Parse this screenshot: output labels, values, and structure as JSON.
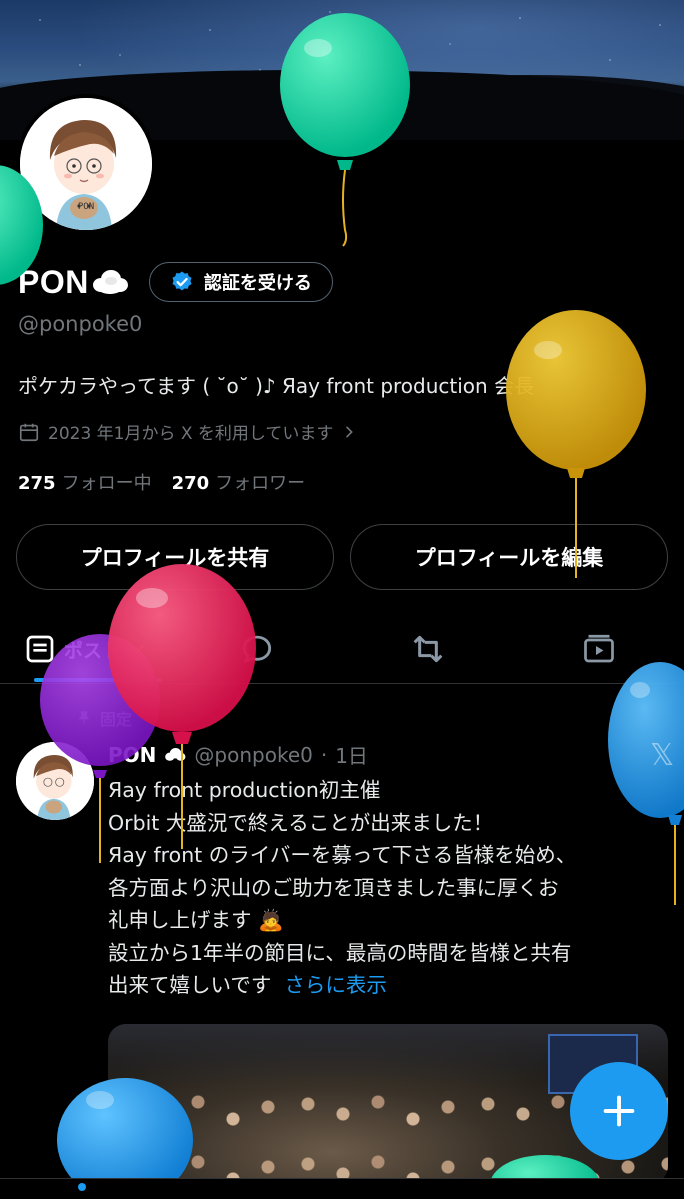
{
  "profile": {
    "display_name": "PON",
    "verify_button": "認証を受ける",
    "handle": "@ponpoke0",
    "bio": "ポケカラやってます ( ˘o˘ )♪ Яay front production 会長",
    "joined": "2023 年1月から X を利用しています",
    "following_count": "275",
    "following_label": "フォロー中",
    "followers_count": "270",
    "followers_label": "フォロワー"
  },
  "buttons": {
    "share_profile": "プロフィールを共有",
    "edit_profile": "プロフィールを編集"
  },
  "tabs": {
    "posts": "ポスト"
  },
  "post": {
    "pinned_label": "固定",
    "author": "PON",
    "handle": "@ponpoke0",
    "time": "1日",
    "lines": [
      "Яay front production初主催",
      "Orbit 大盛況で終えることが出来ました！",
      "Яay front のライバーを募って下さる皆様を始め、",
      "各方面より沢山のご助力を頂きました事に厚くお",
      "礼申し上げます 🙇",
      "設立から1年半の節目に、最高の時間を皆様と共有"
    ],
    "last_line": "出来て嬉しいです",
    "show_more": "さらに表示"
  },
  "avatar_caption": "PON",
  "colors": {
    "accent": "#1d9bf0",
    "muted": "#71767b"
  },
  "icons": [
    "calendar-icon",
    "chevron-right-icon",
    "verified-badge-icon",
    "pin-icon",
    "chevron-down-icon",
    "reply-icon",
    "repost-icon",
    "video-icon",
    "plus-icon",
    "x-logo-icon"
  ]
}
